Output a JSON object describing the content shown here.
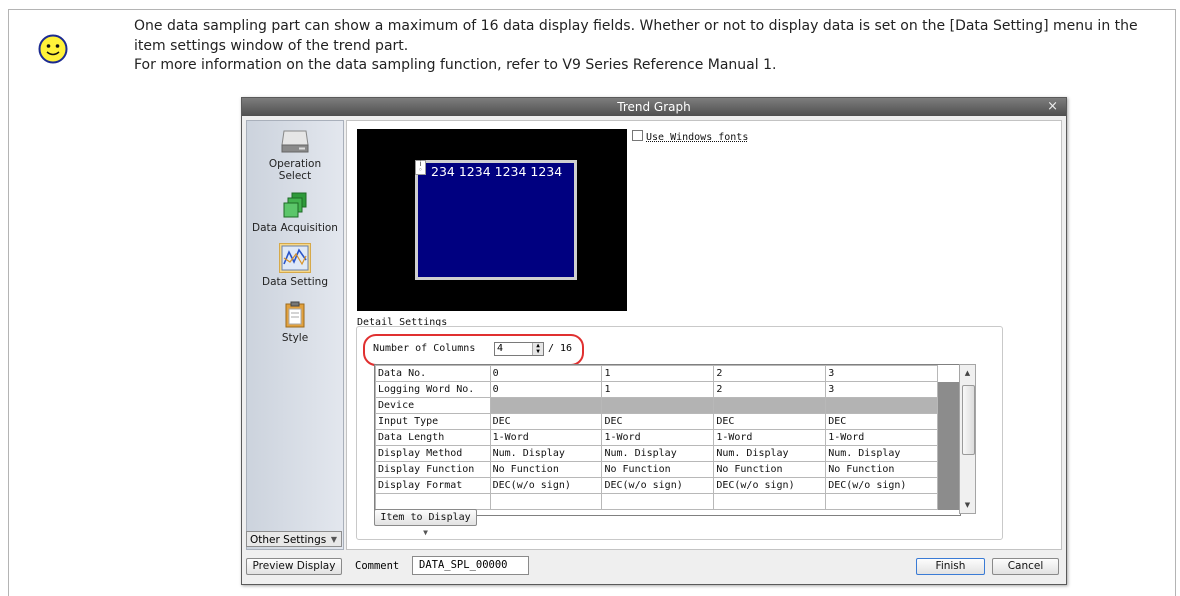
{
  "note": {
    "line1": "One data sampling part can show a maximum of 16 data display fields. Whether or not to display data is set on the [Data Setting] menu in the item settings window of the trend part.",
    "line2": "For more information on the data sampling function, refer to V9 Series Reference Manual 1."
  },
  "dialog": {
    "title": "Trend Graph",
    "close": "×"
  },
  "sidebar": {
    "items": [
      {
        "label": "Operation Select",
        "icon": "hard-drive-icon"
      },
      {
        "label": "Data Acquisition",
        "icon": "green-blocks-icon"
      },
      {
        "label": "Data Setting",
        "icon": "trend-chart-icon",
        "active": true
      },
      {
        "label": "Style",
        "icon": "clipboard-icon"
      }
    ],
    "other_settings": "Other Settings"
  },
  "preview": {
    "digits": "234 1234 1234 1234",
    "use_windows_fonts": "Use Windows fonts"
  },
  "detail": {
    "group_label": "Detail Settings",
    "columns_label": "Number of Columns",
    "columns_value": "4",
    "columns_max": "/ 16",
    "item_to_display": "Item to Display"
  },
  "table": {
    "header": [
      "Data No.",
      "0",
      "1",
      "2",
      "3"
    ],
    "rows": [
      [
        "Logging Word No.",
        "0",
        "1",
        "2",
        "3"
      ],
      [
        "Device",
        "",
        "",
        "",
        ""
      ],
      [
        "Input Type",
        "DEC",
        "DEC",
        "DEC",
        "DEC"
      ],
      [
        "Data Length",
        "1-Word",
        "1-Word",
        "1-Word",
        "1-Word"
      ],
      [
        "Display Method",
        "Num. Display",
        "Num. Display",
        "Num. Display",
        "Num. Display"
      ],
      [
        "Display Function",
        "No Function",
        "No Function",
        "No Function",
        "No Function"
      ],
      [
        "Display Format",
        "DEC(w/o sign)",
        "DEC(w/o sign)",
        "DEC(w/o sign)",
        "DEC(w/o sign)"
      ]
    ]
  },
  "footer": {
    "preview_display": "Preview Display",
    "comment_label": "Comment",
    "comment_value": "DATA_SPL_00000",
    "finish": "Finish",
    "cancel": "Cancel"
  }
}
